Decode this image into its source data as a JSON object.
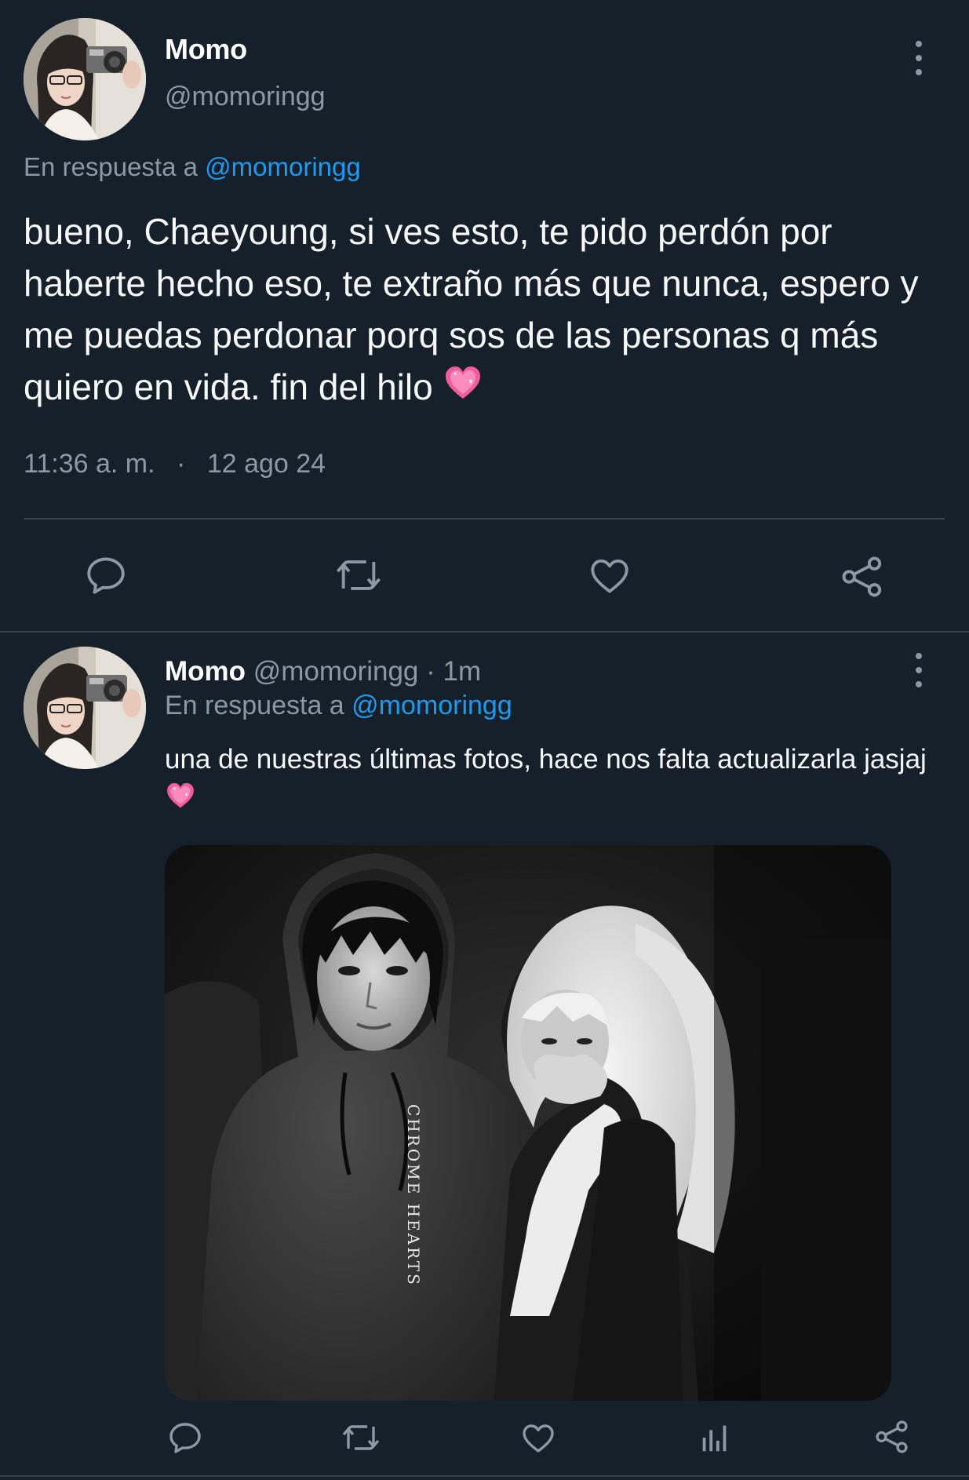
{
  "main_tweet": {
    "author_name": "Momo",
    "author_handle": "@momoringg",
    "reply_prefix": "En respuesta a",
    "reply_mention": "@momoringg",
    "text": "bueno, Chaeyoung, si ves esto, te pido perdón por haberte hecho eso, te extraño más que nunca, espero y me puedas perdonar porq sos de las personas q más quiero en vida. fin del hilo",
    "time": "11:36 a. m.",
    "separator": "·",
    "date": "12 ago 24",
    "actions": [
      "reply-icon",
      "retweet-icon",
      "like-icon",
      "share-icon"
    ]
  },
  "second_tweet": {
    "author_name": "Momo",
    "author_handle": "@momoringg",
    "time_ago": "· 1m",
    "reply_prefix": "En respuesta a",
    "reply_mention": "@momoringg",
    "text": "una de nuestras últimas fotos, hace nos falta actualizarla jasjaj",
    "photo_shirt_text": "CHROME HEARTS",
    "actions": [
      "reply-icon",
      "retweet-icon",
      "like-icon",
      "views-icon",
      "share-icon"
    ]
  },
  "colors": {
    "background": "#15202b",
    "text_primary": "#f7f9f9",
    "text_secondary": "#8b98a5",
    "accent": "#1d9bf0",
    "divider": "#38444d",
    "heart_emoji": "#f25c9a"
  }
}
